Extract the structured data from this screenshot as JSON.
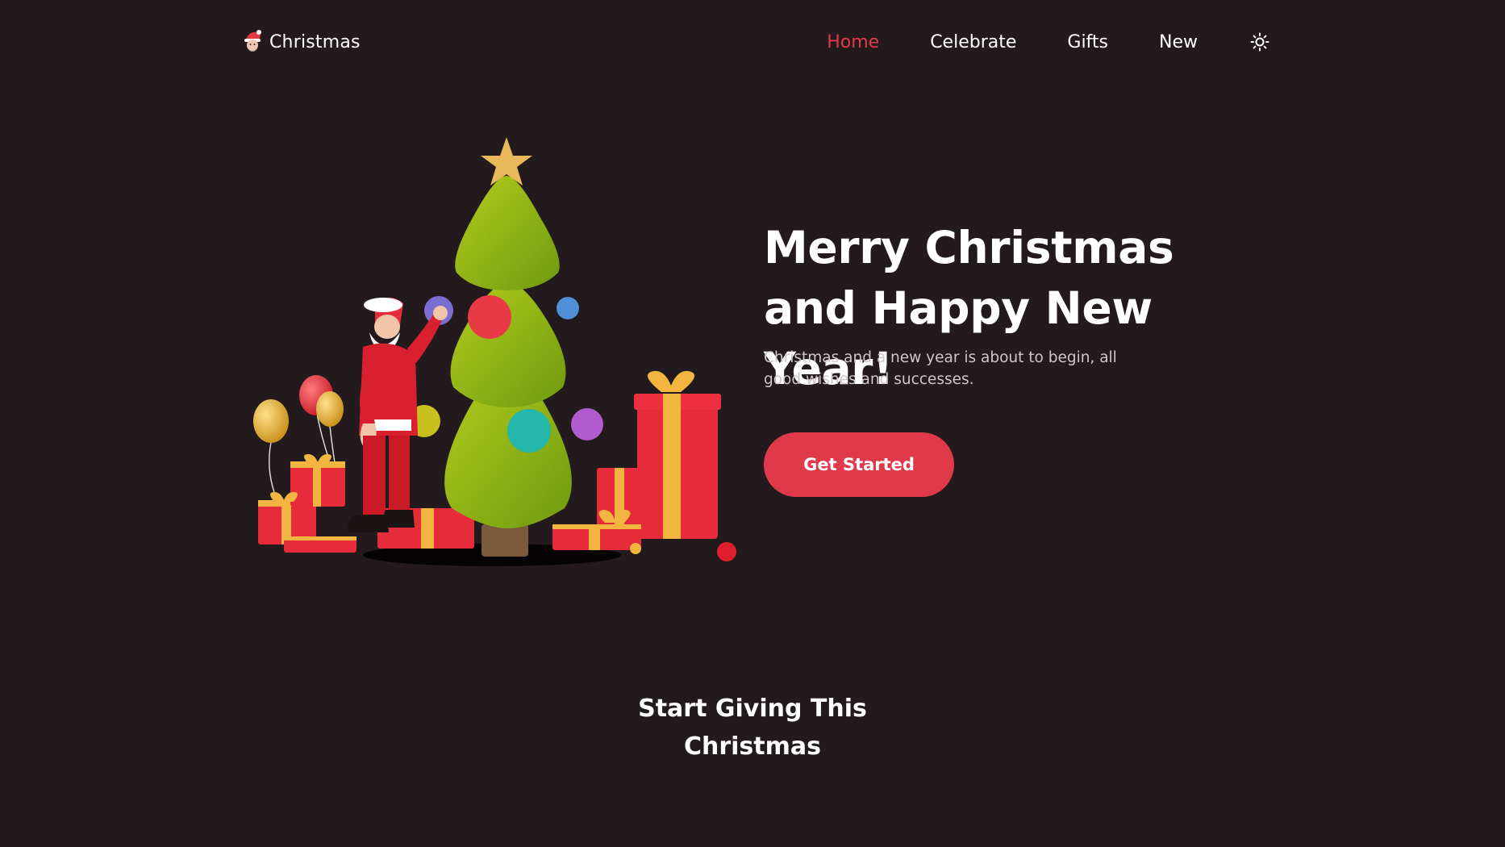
{
  "header": {
    "brand": {
      "label": "Christmas",
      "icon": "santa-icon"
    },
    "nav": [
      {
        "label": "Home",
        "active": true
      },
      {
        "label": "Celebrate",
        "active": false
      },
      {
        "label": "Gifts",
        "active": false
      },
      {
        "label": "New",
        "active": false
      }
    ],
    "theme_toggle_icon": "sun-icon"
  },
  "hero": {
    "title": "Merry Christmas and Happy New Year!",
    "description": "Christmas and a new year is about to begin, all good wishes and successes.",
    "cta_label": "Get Started"
  },
  "section": {
    "title": "Start Giving This Christmas"
  },
  "colors": {
    "background": "#221a1c",
    "accent": "#e03a4a",
    "text": "#ffffff",
    "muted_text": "#cfc6c8"
  }
}
